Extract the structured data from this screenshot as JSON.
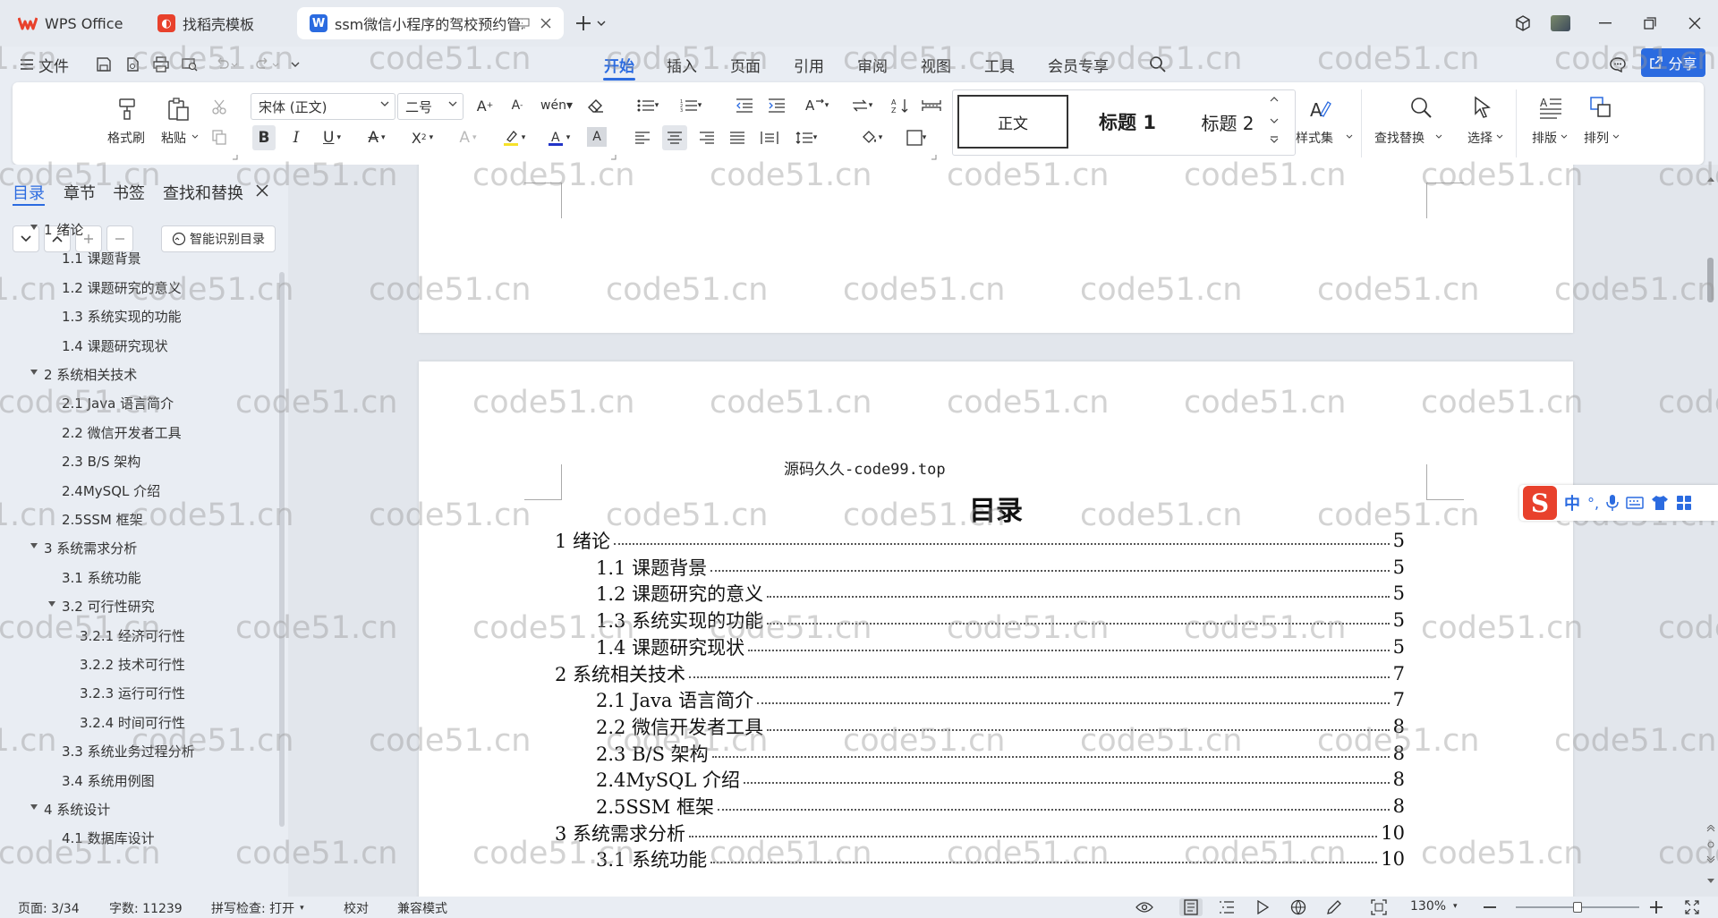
{
  "tabs": [
    {
      "label": "WPS Office",
      "icon": "wps-logo-icon",
      "active": false
    },
    {
      "label": "找稻壳模板",
      "icon": "docer-icon",
      "active": false
    },
    {
      "label": "ssm微信小程序的驾校预约管理",
      "icon": "wps-writer-icon",
      "active": true
    }
  ],
  "menu": {
    "file": "文件",
    "tabs": [
      "开始",
      "插入",
      "页面",
      "引用",
      "审阅",
      "视图",
      "工具",
      "会员专享"
    ],
    "share": "分享"
  },
  "ribbon": {
    "format_painter": "格式刷",
    "paste": "粘贴",
    "font_name": "宋体 (正文)",
    "font_size": "二号",
    "styles": [
      "正文",
      "标题 1",
      "标题 2"
    ],
    "style_set": "样式集",
    "find_replace": "查找替换",
    "select": "选择",
    "layout": "排版",
    "arrange": "排列"
  },
  "nav": {
    "tabs": [
      "目录",
      "章节",
      "书签",
      "查找和替换"
    ],
    "smart_toc": "智能识别目录",
    "items": [
      {
        "level": 1,
        "text": "1 绪论",
        "expanded": true
      },
      {
        "level": 2,
        "text": "1.1 课题背景"
      },
      {
        "level": 2,
        "text": "1.2 课题研究的意义"
      },
      {
        "level": 2,
        "text": "1.3  系统实现的功能"
      },
      {
        "level": 2,
        "text": "1.4 课题研究现状"
      },
      {
        "level": 1,
        "text": "2 系统相关技术",
        "expanded": true
      },
      {
        "level": 2,
        "text": "2.1 Java 语言简介"
      },
      {
        "level": 2,
        "text": "2.2 微信开发者工具"
      },
      {
        "level": 2,
        "text": "2.3 B/S 架构"
      },
      {
        "level": 2,
        "text": "2.4MySQL  介绍"
      },
      {
        "level": 2,
        "text": "2.5SSM 框架"
      },
      {
        "level": 1,
        "text": "3 系统需求分析",
        "expanded": true
      },
      {
        "level": 2,
        "text": "3.1 系统功能"
      },
      {
        "level": 2,
        "text": "3.2 可行性研究",
        "expanded": true
      },
      {
        "level": 3,
        "text": "3.2.1  经济可行性"
      },
      {
        "level": 3,
        "text": "3.2.2  技术可行性"
      },
      {
        "level": 3,
        "text": "3.2.3  运行可行性"
      },
      {
        "level": 3,
        "text": "3.2.4  时间可行性"
      },
      {
        "level": 2,
        "text": "3.3 系统业务过程分析"
      },
      {
        "level": 2,
        "text": "3.4 系统用例图"
      },
      {
        "level": 1,
        "text": "4 系统设计",
        "expanded": true
      },
      {
        "level": 2,
        "text": "4.1 数据库设计"
      }
    ]
  },
  "document": {
    "header_text": "源码久久-code99.top",
    "toc_title": "目录",
    "toc": [
      {
        "level": 1,
        "text": "1  绪论",
        "page": "5"
      },
      {
        "level": 2,
        "text": "1.1 课题背景",
        "page": "5"
      },
      {
        "level": 2,
        "text": "1.2 课题研究的意义",
        "page": "5"
      },
      {
        "level": 2,
        "text": "1.3  系统实现的功能",
        "page": "5"
      },
      {
        "level": 2,
        "text": "1.4 课题研究现状",
        "page": "5"
      },
      {
        "level": 1,
        "text": "2 系统相关技术",
        "page": "7"
      },
      {
        "level": 2,
        "text": "2.1 Java 语言简介",
        "page": "7"
      },
      {
        "level": 2,
        "text": "2.2 微信开发者工具",
        "page": "8"
      },
      {
        "level": 2,
        "text": "2.3 B/S 架构",
        "page": "8"
      },
      {
        "level": 2,
        "text": "2.4MySQL  介绍",
        "page": "8"
      },
      {
        "level": 2,
        "text": "2.5SSM 框架",
        "page": "8"
      },
      {
        "level": 1,
        "text": "3 系统需求分析",
        "page": "10"
      },
      {
        "level": 2,
        "text": "3.1 系统功能",
        "page": "10"
      }
    ]
  },
  "watermark": "code51.cn",
  "ime": {
    "mode": "中"
  },
  "status": {
    "page": "页面: 3/34",
    "words": "字数: 11239",
    "spell": "拼写检查: 打开",
    "proof": "校对",
    "compat": "兼容模式",
    "zoom": "130%"
  },
  "colors": {
    "accent": "#2b6be0",
    "wps_red": "#e8412c"
  }
}
